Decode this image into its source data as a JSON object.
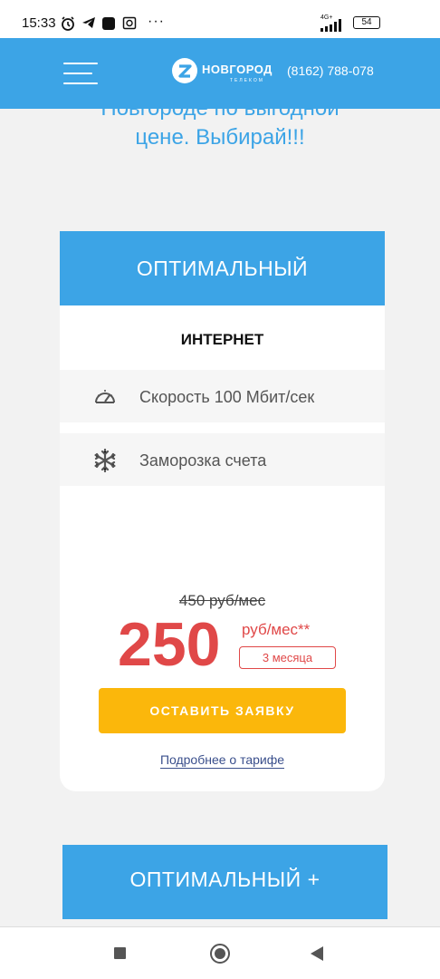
{
  "status_bar": {
    "time": "15:33",
    "network": "4G+",
    "battery": "54"
  },
  "header": {
    "logo_text": "НОВГОРОД",
    "logo_subtext": "ТЕЛЕКОМ",
    "phone": "(8162) 788-078"
  },
  "headline": {
    "line1": "Новгороде по выгодной",
    "line2": "цене. Выбирай!!!"
  },
  "tariff": {
    "title": "ОПТИМАЛЬНЫЙ",
    "category": "ИНТЕРНЕТ",
    "features": [
      {
        "icon": "speedometer-icon",
        "text": "Скорость 100 Мбит/сек"
      },
      {
        "icon": "snowflake-icon",
        "text": "Заморозка счета"
      }
    ],
    "old_price": "450 руб/мес",
    "price": "250",
    "price_unit": "руб/мес**",
    "period": "3 месяца",
    "order_button": "ОСТАВИТЬ ЗАЯВКУ",
    "details_link": "Подробнее о тарифе"
  },
  "next_tariff": {
    "title": "ОПТИМАЛЬНЫЙ +"
  },
  "colors": {
    "brand_blue": "#3ca4e6",
    "price_red": "#e04848",
    "button_yellow": "#fbb70b",
    "link_blue": "#3a4f8c"
  }
}
